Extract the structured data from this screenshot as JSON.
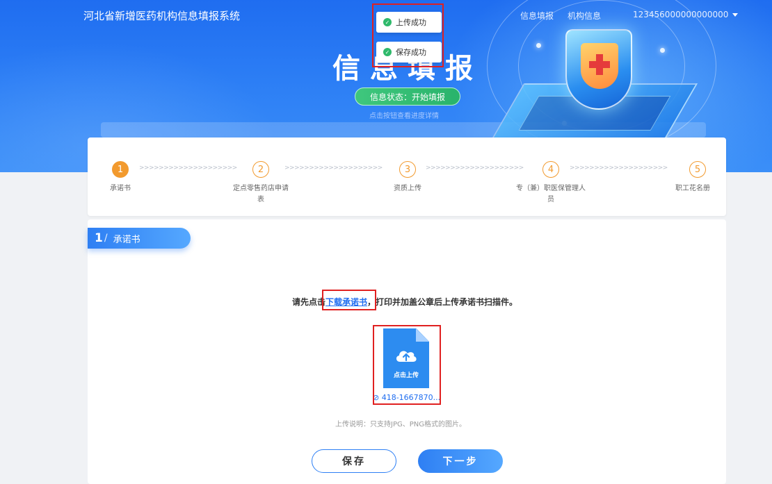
{
  "header": {
    "site_title": "河北省新增医药机构信息填报系统",
    "nav": [
      "信息填报",
      "机构信息"
    ],
    "user_id": "123456000000000000",
    "big_title": "信息填报",
    "status_label": "信息状态：开始填报",
    "status_hint": "点击按钮查看进度详情"
  },
  "toasts": [
    {
      "text": "上传成功",
      "icon": "check-circle-icon"
    },
    {
      "text": "保存成功",
      "icon": "check-circle-icon"
    }
  ],
  "steps": [
    {
      "num": "1",
      "label": "承诺书",
      "active": true
    },
    {
      "num": "2",
      "label": "定点零售药店申请表",
      "active": false
    },
    {
      "num": "3",
      "label": "资质上传",
      "active": false
    },
    {
      "num": "4",
      "label": "专（兼）职医保管理人员",
      "active": false
    },
    {
      "num": "5",
      "label": "职工花名册",
      "active": false
    }
  ],
  "step_arrows": ">>>>>>>>>>>>>>>>>>>>",
  "section": {
    "num": "1",
    "title": "承诺书"
  },
  "instruction": {
    "prefix": "请先点击",
    "link": "下载承诺书",
    "suffix": "，打印并加盖公章后上传承诺书扫描件。"
  },
  "upload": {
    "button_text": "点击上传",
    "file_name": "418-1667870...",
    "note": "上传说明：只支持JPG、PNG格式的图片。"
  },
  "buttons": {
    "save": "保存",
    "next": "下一步"
  },
  "colors": {
    "primary": "#2d7ff5",
    "step_accent": "#f29a2e",
    "success": "#2fb96b",
    "annotation_red": "#e02020"
  }
}
